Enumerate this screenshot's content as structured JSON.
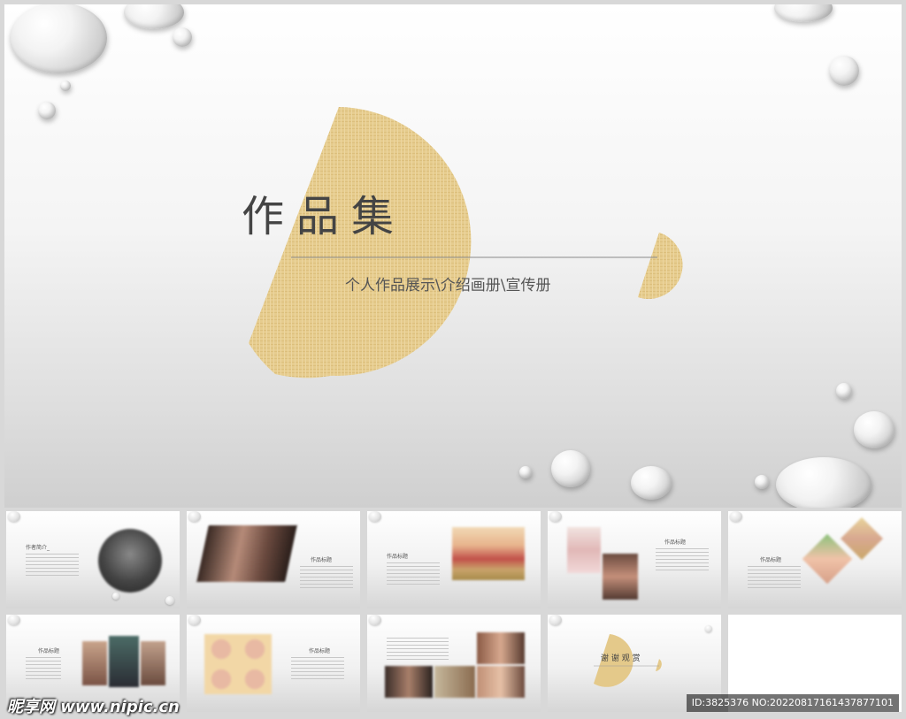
{
  "slide": {
    "title": "作品集",
    "subtitle": "个人作品展示\\介绍画册\\宣传册",
    "accent_color": "#e4c98a"
  },
  "thumbnails": [
    {
      "id": "t1",
      "heading": "作者简介_"
    },
    {
      "id": "t2",
      "heading": "作品标题"
    },
    {
      "id": "t3",
      "heading": "作品标题"
    },
    {
      "id": "t4",
      "heading": "作品标题"
    },
    {
      "id": "t5",
      "heading": "作品标题"
    },
    {
      "id": "t6",
      "heading": "作品标题"
    },
    {
      "id": "t7",
      "heading": "作品标题"
    },
    {
      "id": "t8",
      "heading": ""
    },
    {
      "id": "t9",
      "heading": "谢 谢 观 赏"
    },
    {
      "id": "t10",
      "heading": ""
    }
  ],
  "watermark": {
    "site": "昵享网 www.nipic.cn",
    "id_text": "ID:3825376 NO:20220817161437877101"
  }
}
